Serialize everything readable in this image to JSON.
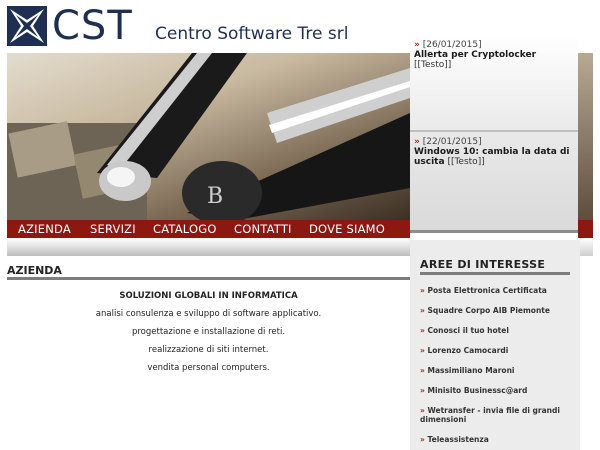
{
  "header": {
    "logo_text": "CST",
    "company_name": "Centro Software Tre srl"
  },
  "menu": {
    "items": [
      {
        "label": "AZIENDA"
      },
      {
        "label": "SERVIZI"
      },
      {
        "label": "CATALOGO"
      },
      {
        "label": "CONTATTI"
      },
      {
        "label": "DOVE SIAMO"
      }
    ]
  },
  "news": {
    "items": [
      {
        "date": "[26/01/2015]",
        "title": "Allerta per Cryptolocker",
        "link": "[[Testo]]"
      },
      {
        "date": "[22/01/2015]",
        "title": "Windows 10: cambia la data di uscita",
        "link": "[[Testo]]"
      }
    ]
  },
  "section": {
    "title": "AZIENDA",
    "headline": "SOLUZIONI GLOBALI IN INFORMATICA",
    "lines": [
      "analisi consulenza e sviluppo di software applicativo.",
      "progettazione e installazione di reti.",
      "realizzazione di siti internet.",
      "vendita personal computers."
    ]
  },
  "aree": {
    "title": "AREE DI INTERESSE",
    "items": [
      "Posta Elettronica Certificata",
      "Squadre Corpo AIB Piemonte",
      "Conosci il tuo hotel",
      "Lorenzo Camocardi",
      "Massimiliano Maroni",
      "Minisito Businessc@ard",
      "Wetransfer - invia file di grandi dimensioni",
      "Teleassistenza"
    ]
  },
  "colors": {
    "brand": "#1f2f52",
    "menu_bar": "#8d1812",
    "arrow": "#a12a1f"
  }
}
